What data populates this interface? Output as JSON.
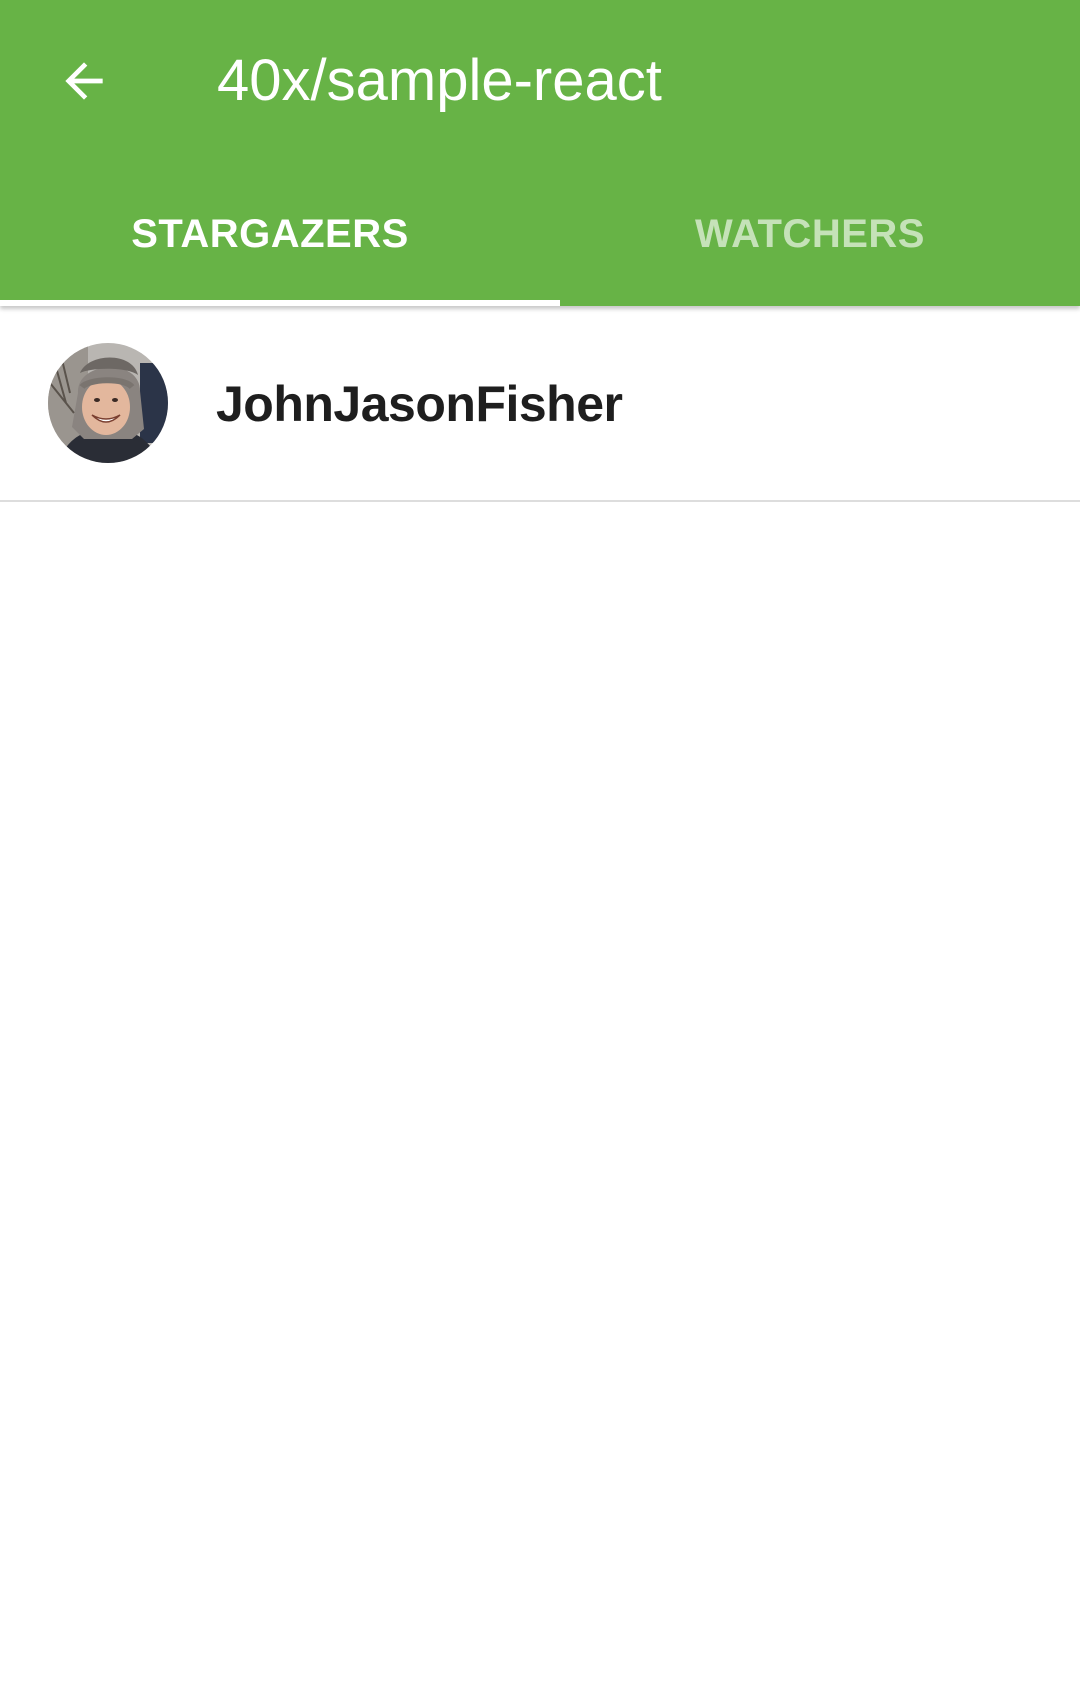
{
  "header": {
    "title": "40x/sample-react",
    "back_icon": "arrow-back-icon",
    "background_color": "#67b346"
  },
  "tabs": [
    {
      "label": "STARGAZERS",
      "active": true
    },
    {
      "label": "WATCHERS",
      "active": false
    }
  ],
  "list": {
    "items": [
      {
        "name": "JohnJasonFisher",
        "avatar": "user-avatar"
      }
    ]
  }
}
